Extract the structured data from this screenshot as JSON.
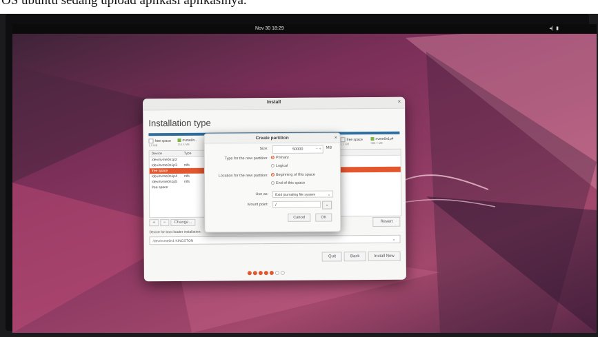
{
  "caption": "OS ubuntu sedang upload aplikasi aplikasinya.",
  "topbar": {
    "clock": "Nov 30  18:29",
    "tray_icons": [
      "sound-icon",
      "battery-icon"
    ]
  },
  "window": {
    "title": "Install",
    "heading": "Installation type",
    "legend": [
      {
        "label": "free space",
        "size": "1.0 MB",
        "color": "#ffffff"
      },
      {
        "label": "nvme0n...",
        "size": "214.4 MB",
        "color": "#7ab648"
      },
      {
        "label": "free space",
        "size": "1.1 GB",
        "color": "#ffffff"
      },
      {
        "label": "nvme0n1p4",
        "size": "983.7 MB",
        "color": "#7ab648"
      }
    ],
    "table": {
      "headers": [
        "Device",
        "Type"
      ],
      "rows": [
        {
          "device": "/dev/nvme0n1p2",
          "type": ""
        },
        {
          "device": "/dev/nvme0n1p3",
          "type": "ntfs"
        },
        {
          "device": "free space",
          "type": ""
        },
        {
          "device": "/dev/nvme0n1p4",
          "type": "ntfs"
        },
        {
          "device": "/dev/nvme0n1p5",
          "type": "ntfs"
        },
        {
          "device": "free space",
          "type": ""
        }
      ],
      "selected_index": 2
    },
    "table_buttons": [
      "+",
      "−",
      "Change..."
    ],
    "revert": "Revert",
    "boot_label": "Device for boot loader installation:",
    "boot_device": "/dev/nvme0n1   KINGSTON",
    "nav": [
      "Quit",
      "Back",
      "Install Now"
    ],
    "progress": {
      "total": 7,
      "filled": 5
    }
  },
  "dialog": {
    "title": "Create partition",
    "size_label": "Size:",
    "size_value": "50000",
    "size_unit": "MB",
    "type_label": "Type for the new partition:",
    "type_options": [
      "Primary",
      "Logical"
    ],
    "location_label": "Location for the new partition:",
    "location_options": [
      "Beginning of this space",
      "End of this space"
    ],
    "use_as_label": "Use as:",
    "use_as_value": "Ext4 journaling file system",
    "mount_label": "Mount point:",
    "mount_value": "/",
    "cancel": "Cancel",
    "ok": "OK"
  },
  "colors": {
    "accent": "#e3572f",
    "bar": "#2f6f9f",
    "wallpaper": "#8e3a63"
  }
}
